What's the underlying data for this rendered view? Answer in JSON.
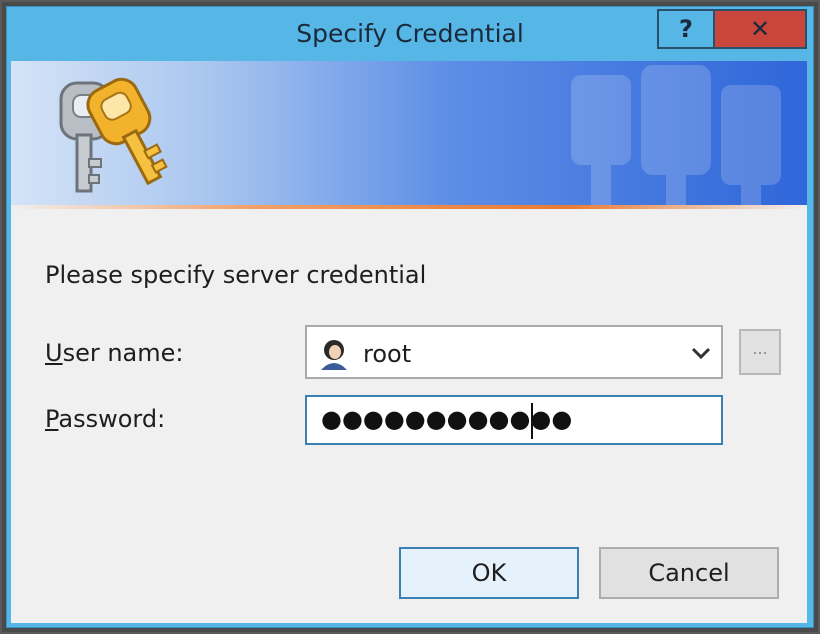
{
  "window": {
    "title": "Specify Credential",
    "help_label": "?",
    "close_label": "✕"
  },
  "dialog": {
    "prompt": "Please specify server credential",
    "user_label_key": "U",
    "user_label_rest": "ser name:",
    "user_value": "root",
    "browse_label": "...",
    "password_label_key": "P",
    "password_label_rest": "assword:",
    "password_value": "●●●●●●●●●●●●"
  },
  "buttons": {
    "ok": "OK",
    "cancel": "Cancel"
  },
  "icons": {
    "banner": "keys-icon",
    "user": "user-avatar-icon",
    "dropdown": "chevron-down-icon"
  },
  "colors": {
    "titlebar": "#56b6e6",
    "close": "#c9463d",
    "accent": "#3c7fb1"
  }
}
